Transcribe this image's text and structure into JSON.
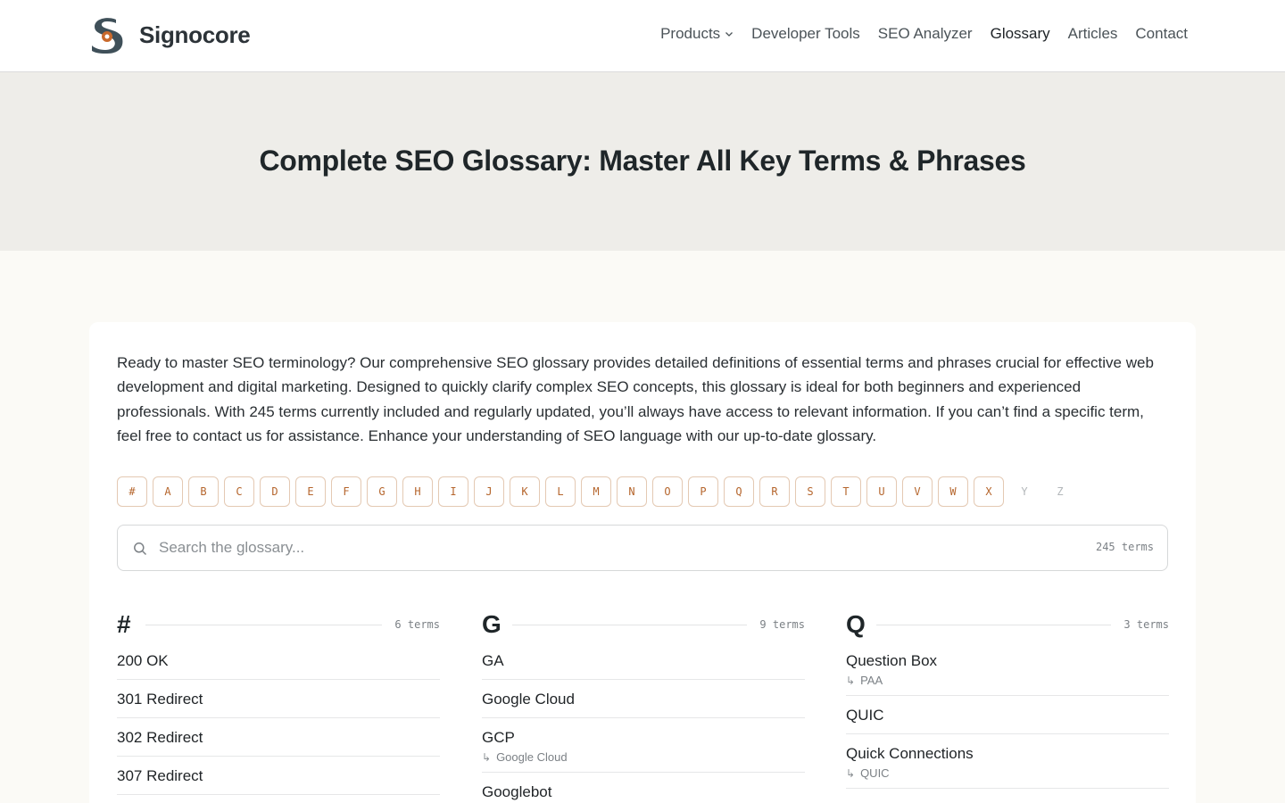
{
  "header": {
    "brand": "Signocore",
    "nav": [
      {
        "label": "Products",
        "dropdown": true
      },
      {
        "label": "Developer Tools"
      },
      {
        "label": "SEO Analyzer"
      },
      {
        "label": "Glossary",
        "active": true
      },
      {
        "label": "Articles"
      },
      {
        "label": "Contact"
      }
    ]
  },
  "hero": {
    "title": "Complete SEO Glossary: Master All Key Terms & Phrases"
  },
  "intro": "Ready to master SEO terminology? Our comprehensive SEO glossary provides detailed definitions of essential terms and phrases crucial for effective web development and digital marketing. Designed to quickly clarify complex SEO concepts, this glossary is ideal for both beginners and experienced professionals. With 245 terms currently included and regularly updated, you’ll always have access to relevant information. If you can’t find a specific term, feel free to contact us for assistance. Enhance your understanding of SEO language with our up-to-date glossary.",
  "letters": {
    "active": [
      "#",
      "A",
      "B",
      "C",
      "D",
      "E",
      "F",
      "G",
      "H",
      "I",
      "J",
      "K",
      "L",
      "M",
      "N",
      "O",
      "P",
      "Q",
      "R",
      "S",
      "T",
      "U",
      "V",
      "W",
      "X"
    ],
    "disabled": [
      "Y",
      "Z"
    ]
  },
  "search": {
    "placeholder": "Search the glossary...",
    "count": "245 terms"
  },
  "columns": [
    {
      "letter": "#",
      "count": "6 terms",
      "terms": [
        {
          "name": "200 OK"
        },
        {
          "name": "301 Redirect"
        },
        {
          "name": "302 Redirect"
        },
        {
          "name": "307 Redirect"
        }
      ]
    },
    {
      "letter": "G",
      "count": "9 terms",
      "terms": [
        {
          "name": "GA"
        },
        {
          "name": "Google Cloud"
        },
        {
          "name": "GCP",
          "alias": "Google Cloud"
        },
        {
          "name": "Googlebot"
        }
      ]
    },
    {
      "letter": "Q",
      "count": "3 terms",
      "terms": [
        {
          "name": "Question Box",
          "alias": "PAA"
        },
        {
          "name": "QUIC"
        },
        {
          "name": "Quick Connections",
          "alias": "QUIC"
        }
      ]
    }
  ],
  "colors": {
    "accent": "#b5652c",
    "logo_dark": "#3f5059",
    "logo_accent": "#c9692c"
  }
}
